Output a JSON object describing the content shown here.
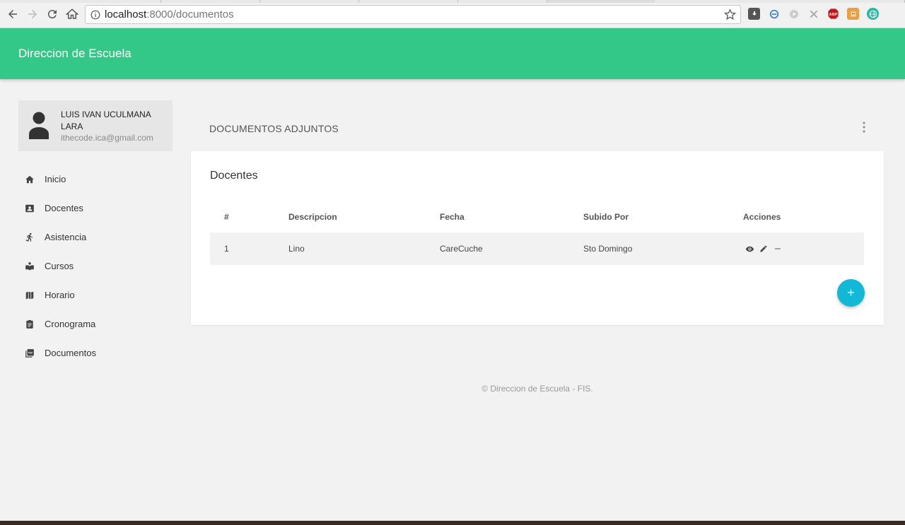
{
  "browser": {
    "url_host": "localhost",
    "url_path": ":8000/documentos",
    "colors": {
      "abp": "#c4161c",
      "ext2": "#e8a040",
      "ext3": "#2bb6a3"
    }
  },
  "header": {
    "title": "Direccion de Escuela",
    "color": "#33c887"
  },
  "user": {
    "name": "LUIS IVAN UCULMANA LARA",
    "email": "ithecode.ica@gmail.com"
  },
  "sidebar": {
    "items": [
      {
        "label": "Inicio",
        "icon": "home-icon"
      },
      {
        "label": "Docentes",
        "icon": "contact-card-icon"
      },
      {
        "label": "Asistencia",
        "icon": "running-person-icon"
      },
      {
        "label": "Cursos",
        "icon": "book-icon"
      },
      {
        "label": "Horario",
        "icon": "map-icon"
      },
      {
        "label": "Cronograma",
        "icon": "clipboard-icon"
      },
      {
        "label": "Documentos",
        "icon": "pdf-icon"
      }
    ]
  },
  "main": {
    "section_title": "DOCUMENTOS ADJUNTOS",
    "card_title": "Docentes",
    "table": {
      "headers": [
        "#",
        "Descripcion",
        "Fecha",
        "Subido Por",
        "Acciones"
      ],
      "rows": [
        {
          "id": "1",
          "descripcion": "Lino",
          "fecha": "CareCuche",
          "subido_por": "Sto Domingo"
        }
      ]
    },
    "fab_label": "+",
    "fab_color": "#12b9d6"
  },
  "footer": {
    "text": "© Direccion de Escuela - FIS."
  }
}
